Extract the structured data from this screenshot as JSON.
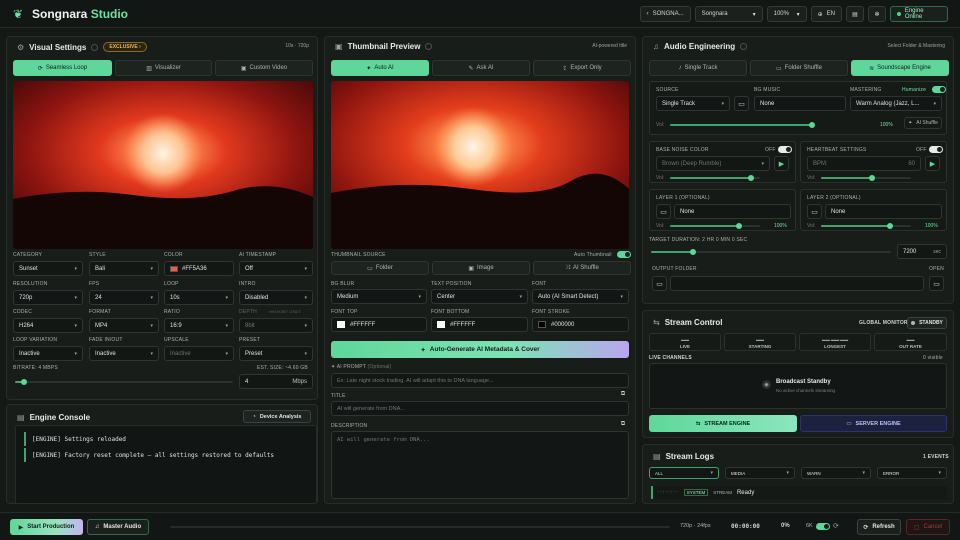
{
  "header": {
    "brand": "Songnara",
    "brand_accent": "Studio",
    "project": "SONGNA...",
    "preset": "Songnara",
    "zoom": "100%",
    "lang": "EN",
    "status": "Engine Online"
  },
  "visual": {
    "title": "Visual Settings",
    "badge": "EXCLUSIVE",
    "badge_arrow": "›",
    "meta": "10s · 720p",
    "tabs": [
      "Seamless Loop",
      "Visualizer",
      "Custom Video"
    ],
    "row1": {
      "labels": [
        "CATEGORY",
        "STYLE",
        "COLOR",
        "AI TIMESTAMP"
      ],
      "values": [
        "Sunset",
        "Bali",
        "#FF5A36",
        "Off"
      ]
    },
    "row2": {
      "labels": [
        "RESOLUTION",
        "FPS",
        "LOOP",
        "INTRO"
      ],
      "values": [
        "720p",
        "24",
        "10s",
        "Disabled"
      ]
    },
    "row3": {
      "labels": [
        "CODEC",
        "FORMAT",
        "RATIO",
        "DEPTH"
      ],
      "values": [
        "H264",
        "MP4",
        "16:9",
        "8bit"
      ],
      "depth_note": "HIGH-BIT ONLY"
    },
    "row4": {
      "labels": [
        "LOOP VARIATION",
        "FADE IN/OUT",
        "UPSCALE",
        "PRESET"
      ],
      "values": [
        "Inactive",
        "Inactive",
        "Inactive",
        "Preset"
      ]
    },
    "bitrate_label": "BITRATE: 4 MBPS",
    "bitrate": 0.04,
    "est_size": "EST. SIZE: ~4.60 GB",
    "mbps_value": "4",
    "mbps_unit": "Mbps"
  },
  "console": {
    "title": "Engine Console",
    "button": "Device Analysis",
    "lines": [
      "[ENGINE] Settings reloaded",
      "[ENGINE] Factory reset complete — all settings restored to defaults"
    ]
  },
  "thumb": {
    "title": "Thumbnail Preview",
    "meta": "AI-powered title",
    "tabs": [
      "Auto AI",
      "Ask AI",
      "Export Only"
    ],
    "source_label": "THUMBNAIL SOURCE",
    "auto_label": "Auto Thumbnail",
    "source_buttons": [
      "Folder",
      "Image",
      "AI Shuffle"
    ],
    "row1": {
      "labels": [
        "BG BLUR",
        "TEXT POSITION",
        "FONT"
      ],
      "values": [
        "Medium",
        "Center",
        "Auto (AI Smart Detect)"
      ]
    },
    "row2": {
      "labels": [
        "FONT TOP",
        "FONT BOTTOM",
        "FONT STROKE"
      ],
      "values": [
        "#FFFFFF",
        "#FFFFFF",
        "#000000"
      ]
    },
    "generate": "Auto-Generate AI Metadata & Cover",
    "prompt_label": "AI PROMPT",
    "prompt_opt": "(Optional)",
    "prompt_ph": "Ex: Late night stock trading. AI will adapt this to DNA language...",
    "title_label": "TITLE",
    "title_ph": "AI will generate from DNA...",
    "desc_label": "DESCRIPTION",
    "desc_ph": "AI will generate from DNA..."
  },
  "audio": {
    "title": "Audio Engineering",
    "meta": "Select Folder & Mastering",
    "tabs": [
      "Single Track",
      "Folder Shuffle",
      "Soundscape Engine"
    ],
    "labels": [
      "SOURCE",
      "BG MUSIC",
      "MASTERING"
    ],
    "humanize": "Humanize",
    "source": "Single Track",
    "bg_music": "None",
    "mastering": "Warm Analog (Jazz, L...",
    "vol_label": "Vol:",
    "vol_pct": "100%",
    "ai_shuffle": "AI Shuffle",
    "noise_label": "BASE NOISE COLOR",
    "noise_state": "OFF",
    "noise_value": "Brown (Deep Rumble)",
    "hb_label": "HEARTBEAT SETTINGS",
    "hb_state": "OFF",
    "bpm_label": "BPM:",
    "bpm": "60",
    "layer1_label": "LAYER 1 (OPTIONAL)",
    "layer1": "None",
    "layer2_label": "LAYER 2 (OPTIONAL)",
    "layer2": "None",
    "layer_pct": "100%",
    "duration_label": "TARGET DURATION: 2 HR 0 MIN 0 SEC",
    "duration": "7200",
    "duration_unit": "sec",
    "output_label": "OUTPUT FOLDER",
    "open": "OPEN"
  },
  "stream": {
    "title": "Stream Control",
    "monitor": "GLOBAL MONITOR",
    "standby": "STANDBY",
    "stats": [
      {
        "small": "▬▬",
        "label": "LIVE"
      },
      {
        "small": "▬▬",
        "label": "STARTING"
      },
      {
        "small": "▬▬:▬▬:▬▬",
        "label": "LONGEST"
      },
      {
        "small": "▬▬",
        "label": "OUT RATE"
      }
    ],
    "channels_label": "LIVE CHANNELS",
    "visible": "0 visible",
    "standby_title": "Broadcast Standby",
    "standby_sub": "No active channels streaming",
    "engine_btn": "STREAM ENGINE",
    "server_btn": "SERVER ENGINE"
  },
  "logs": {
    "title": "Stream Logs",
    "events": "1 EVENTS",
    "filters": [
      "ALL",
      "MEDIA",
      "WARN",
      "ERROR"
    ],
    "time": "--:--:--",
    "tag": "SYSTEM",
    "src": "STREAM",
    "msg": "Ready"
  },
  "bottom": {
    "start": "Start Production",
    "master": "Master Audio",
    "info": "720p · 24fps",
    "time": "00:00:00",
    "progress": "0%",
    "sixk": "6K",
    "refresh": "Refresh",
    "cancel": "Cancel"
  }
}
